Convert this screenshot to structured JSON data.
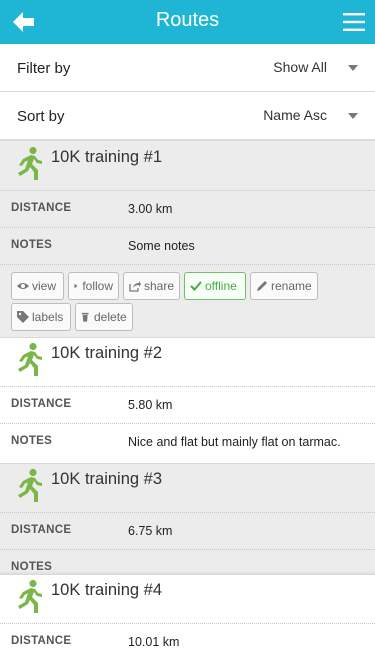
{
  "header": {
    "title": "Routes"
  },
  "filters": [
    {
      "label": "Filter by",
      "value": "Show All"
    },
    {
      "label": "Sort by",
      "value": "Name Asc"
    }
  ],
  "routes": [
    {
      "name": "10K training #1",
      "distance_label": "DISTANCE",
      "distance": "3.00 km",
      "notes_label": "NOTES",
      "notes": "Some notes"
    },
    {
      "name": "10K training #2",
      "distance_label": "DISTANCE",
      "distance": "5.80 km",
      "notes_label": "NOTES",
      "notes": "Nice and flat but mainly flat on tarmac."
    },
    {
      "name": "10K training #3",
      "distance_label": "DISTANCE",
      "distance": "6.75 km",
      "notes_label": "NOTES",
      "notes": ""
    },
    {
      "name": "10K training #4",
      "distance_label": "DISTANCE",
      "distance": "10.01 km"
    }
  ],
  "actions": [
    {
      "label": "view",
      "icon": "eye-icon",
      "active": false
    },
    {
      "label": "follow",
      "icon": "play-icon",
      "active": false
    },
    {
      "label": "share",
      "icon": "share-icon",
      "active": false
    },
    {
      "label": "offline",
      "icon": "check-icon",
      "active": true
    },
    {
      "label": "rename",
      "icon": "pencil-icon",
      "active": false
    },
    {
      "label": "labels",
      "icon": "tag-icon",
      "active": false
    },
    {
      "label": "delete",
      "icon": "trash-icon",
      "active": false
    }
  ],
  "colors": {
    "accent": "#1fb6d6",
    "runner": "#7ab648",
    "offline": "#4aa84a"
  }
}
